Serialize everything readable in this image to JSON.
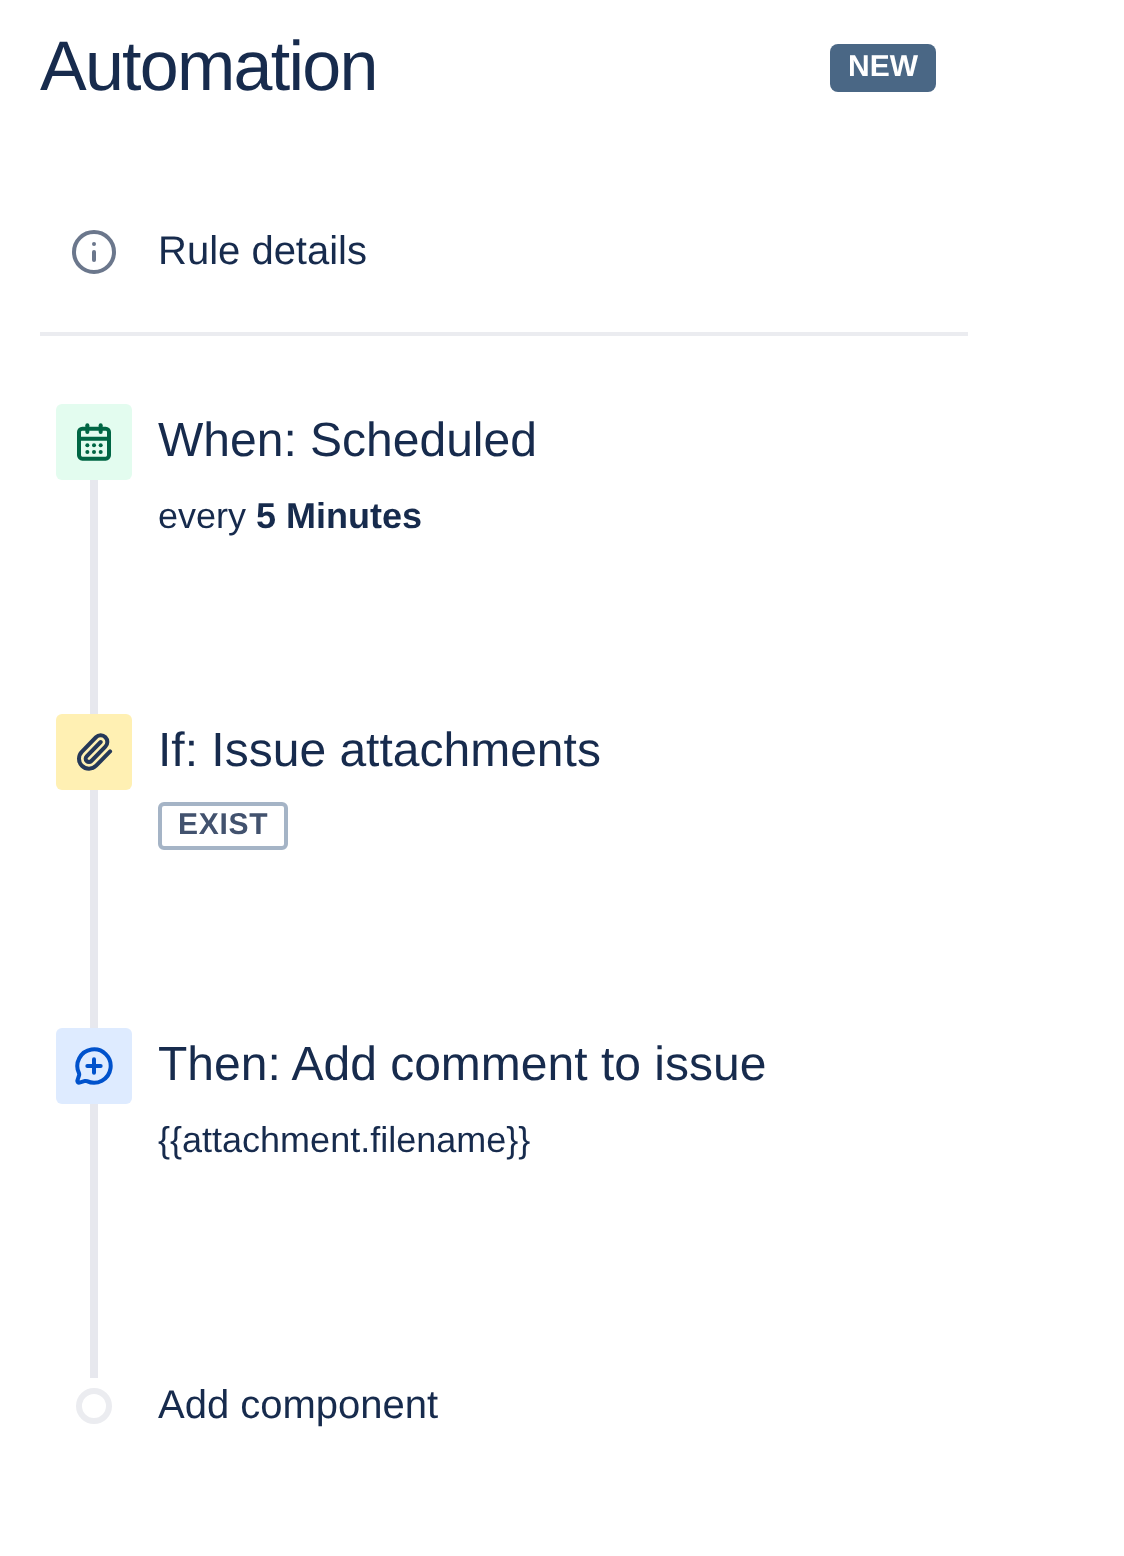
{
  "header": {
    "title": "Automation",
    "badge": "NEW"
  },
  "rule_details": {
    "label": "Rule details"
  },
  "steps": [
    {
      "kind": "when",
      "title": "When: Scheduled",
      "detail": {
        "kind": "text",
        "text": "every **5 Minutes**"
      }
    },
    {
      "kind": "if",
      "title": "If: Issue attachments",
      "detail": {
        "kind": "lozenge",
        "text": "EXIST"
      }
    },
    {
      "kind": "then",
      "title": "Then: Add comment to issue",
      "detail": {
        "kind": "text",
        "text": "{{attachment.filename}}"
      }
    }
  ],
  "add_component": {
    "label": "Add component"
  }
}
